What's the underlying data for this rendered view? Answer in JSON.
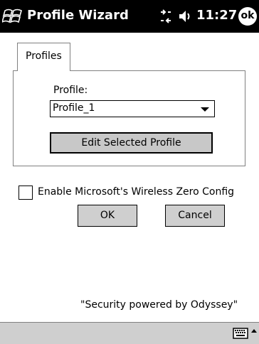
{
  "titlebar": {
    "title": "Profile Wizard",
    "time": "11:27",
    "ok_label": "ok",
    "icons": [
      "windows-start-icon",
      "connectivity-icon",
      "volume-icon"
    ]
  },
  "tabs": [
    {
      "label": "Profiles"
    }
  ],
  "profile": {
    "label": "Profile:",
    "selected": "Profile_1",
    "edit_button": "Edit Selected Profile"
  },
  "wireless_zero_config": {
    "label": "Enable Microsoft's Wireless Zero Config",
    "checked": false
  },
  "buttons": {
    "ok": "OK",
    "cancel": "Cancel"
  },
  "footer": {
    "text": "\"Security powered by Odyssey\""
  },
  "menubar": {
    "icons": [
      "keyboard-icon",
      "sip-arrow-icon"
    ]
  }
}
